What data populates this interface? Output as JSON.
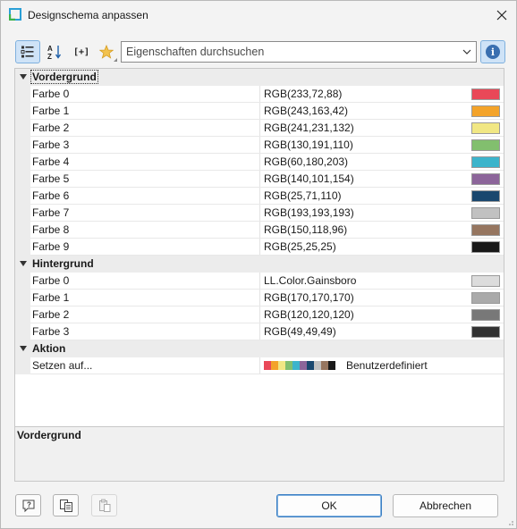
{
  "window": {
    "title": "Designschema anpassen"
  },
  "toolbar": {
    "search_placeholder": "Eigenschaften durchsuchen",
    "expand_label": "[+]"
  },
  "grid": {
    "categories": [
      {
        "name": "Vordergrund",
        "items": [
          {
            "name": "Farbe 0",
            "value": "RGB(233,72,88)",
            "color": "#e94858"
          },
          {
            "name": "Farbe 1",
            "value": "RGB(243,163,42)",
            "color": "#f3a32a"
          },
          {
            "name": "Farbe 2",
            "value": "RGB(241,231,132)",
            "color": "#f1e784"
          },
          {
            "name": "Farbe 3",
            "value": "RGB(130,191,110)",
            "color": "#82bf6e"
          },
          {
            "name": "Farbe 4",
            "value": "RGB(60,180,203)",
            "color": "#3cb4cb"
          },
          {
            "name": "Farbe 5",
            "value": "RGB(140,101,154)",
            "color": "#8c659a"
          },
          {
            "name": "Farbe 6",
            "value": "RGB(25,71,110)",
            "color": "#19476e"
          },
          {
            "name": "Farbe 7",
            "value": "RGB(193,193,193)",
            "color": "#c1c1c1"
          },
          {
            "name": "Farbe 8",
            "value": "RGB(150,118,96)",
            "color": "#967660"
          },
          {
            "name": "Farbe 9",
            "value": "RGB(25,25,25)",
            "color": "#191919"
          }
        ]
      },
      {
        "name": "Hintergrund",
        "items": [
          {
            "name": "Farbe 0",
            "value": "LL.Color.Gainsboro",
            "color": "#dcdcdc"
          },
          {
            "name": "Farbe 1",
            "value": "RGB(170,170,170)",
            "color": "#aaaaaa"
          },
          {
            "name": "Farbe 2",
            "value": "RGB(120,120,120)",
            "color": "#787878"
          },
          {
            "name": "Farbe 3",
            "value": "RGB(49,49,49)",
            "color": "#313131"
          }
        ]
      },
      {
        "name": "Aktion",
        "items": [
          {
            "name": "Setzen auf...",
            "value": "Benutzerdefiniert",
            "palette": [
              "#e94858",
              "#f3a32a",
              "#f1e784",
              "#82bf6e",
              "#3cb4cb",
              "#8c659a",
              "#19476e",
              "#c1c1c1",
              "#967660",
              "#191919"
            ]
          }
        ]
      }
    ]
  },
  "description": {
    "title": "Vordergrund"
  },
  "buttons": {
    "ok": "OK",
    "cancel": "Abbrechen"
  },
  "colors": {
    "accent": "#3c7fc4",
    "selected_bg": "#cfe3f7",
    "category_bg": "#ececec"
  }
}
